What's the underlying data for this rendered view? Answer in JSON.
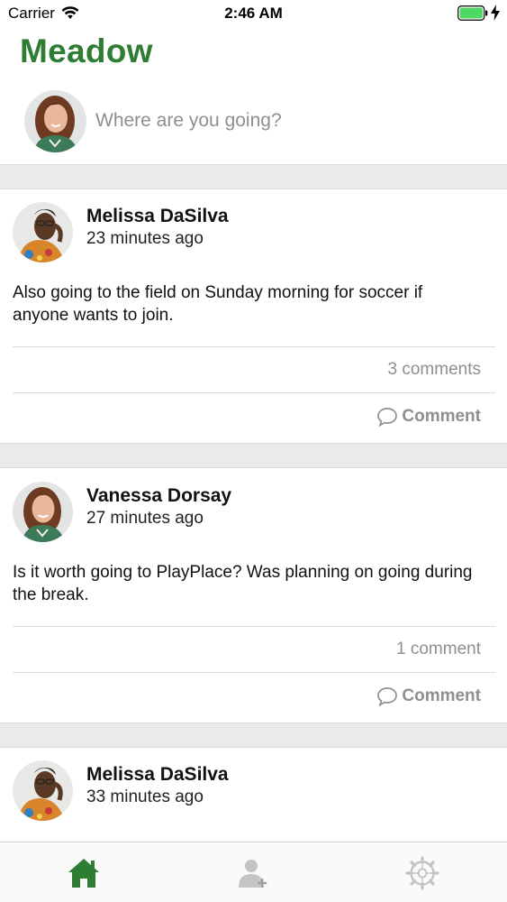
{
  "status_bar": {
    "carrier": "Carrier",
    "time": "2:46 AM"
  },
  "app": {
    "title": "Meadow"
  },
  "composer": {
    "placeholder": "Where are you going?"
  },
  "posts": [
    {
      "author": "Melissa DaSilva",
      "time_ago": "23 minutes ago",
      "text": "Also going to the field on Sunday morning for soccer if anyone wants to join.",
      "comment_count": "3 comments",
      "comment_label": "Comment"
    },
    {
      "author": "Vanessa Dorsay",
      "time_ago": "27 minutes ago",
      "text": "Is it worth going to PlayPlace? Was planning on going during the break.",
      "comment_count": "1 comment",
      "comment_label": "Comment"
    },
    {
      "author": "Melissa DaSilva",
      "time_ago": "33 minutes ago"
    }
  ],
  "tab_bar": {
    "items": [
      {
        "icon": "home-icon",
        "active": true
      },
      {
        "icon": "add-friend-icon",
        "active": false
      },
      {
        "icon": "settings-gear-icon",
        "active": false
      }
    ]
  },
  "colors": {
    "brand_green": "#2e7d32",
    "inactive_tab": "#c4c4c4",
    "muted_text": "#8e8e93",
    "separator": "#e9eaeb"
  }
}
